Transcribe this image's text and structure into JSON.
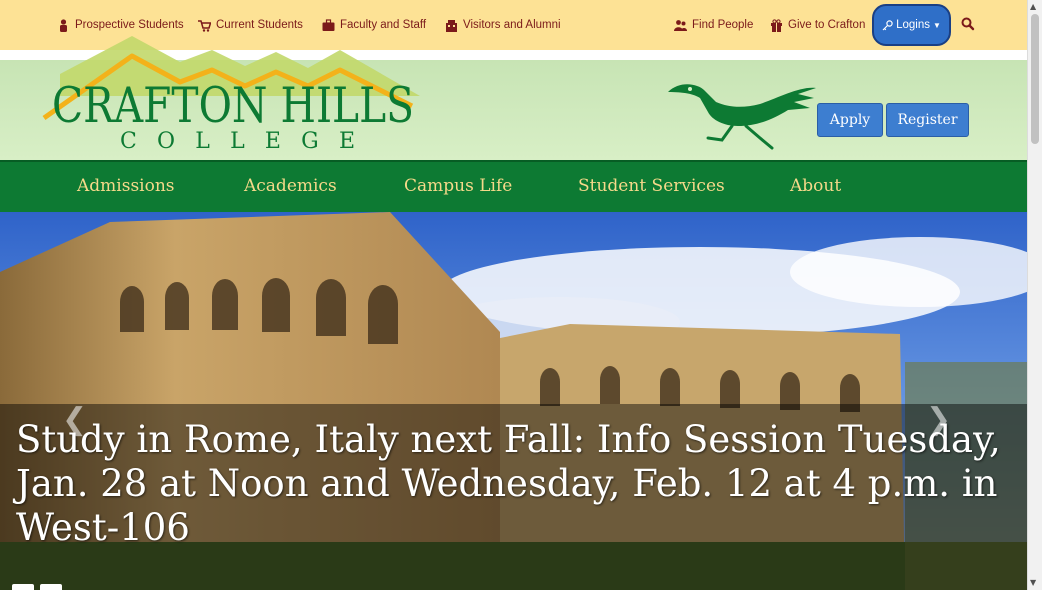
{
  "topbar": {
    "links": [
      {
        "label": "Prospective Students",
        "icon": "student-icon"
      },
      {
        "label": "Current Students",
        "icon": "cart-icon"
      },
      {
        "label": "Faculty and Staff",
        "icon": "briefcase-icon"
      },
      {
        "label": "Visitors and Alumni",
        "icon": "building-icon"
      },
      {
        "label": "Find People",
        "icon": "people-icon"
      },
      {
        "label": "Give to Crafton",
        "icon": "gift-icon"
      }
    ],
    "logins_label": "Logins",
    "search_icon": "search-icon"
  },
  "logo": {
    "line1": "CRAFTON HILLS",
    "line2": "COLLEGE"
  },
  "cta": {
    "apply": "Apply",
    "register": "Register"
  },
  "nav": {
    "items": [
      "Admissions",
      "Academics",
      "Campus Life",
      "Student Services",
      "About"
    ]
  },
  "hero": {
    "caption": "Study in Rome, Italy next Fall: Info Session Tuesday, Jan. 28 at Noon and Wednesday, Feb. 12 at 4 p.m. in West-106",
    "prev_icon": "chevron-left-icon",
    "next_icon": "chevron-right-icon"
  },
  "colors": {
    "topbar_bg": "#fde295",
    "link_color": "#7b1a1a",
    "nav_bg": "#0d7a33",
    "nav_text": "#f5d98a",
    "button_blue": "#3d7ed0"
  }
}
